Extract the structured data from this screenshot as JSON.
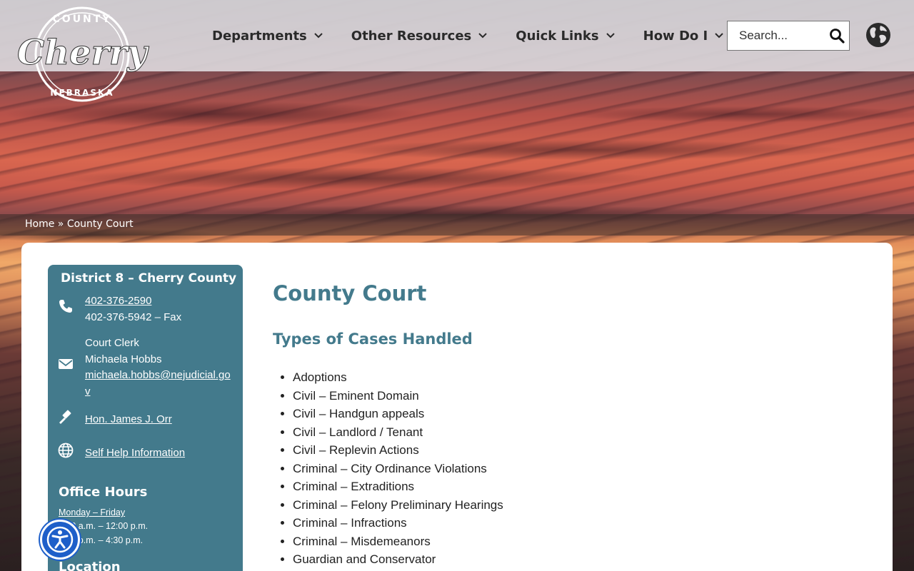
{
  "logo": {
    "top_text": "COUNTY",
    "script_text": "Cherry",
    "bottom_text": "NEBRASKA"
  },
  "nav": {
    "items": [
      {
        "label": "Departments"
      },
      {
        "label": "Other Resources"
      },
      {
        "label": "Quick Links"
      },
      {
        "label": "How Do I"
      }
    ]
  },
  "search": {
    "placeholder": "Search..."
  },
  "breadcrumb": {
    "home": "Home",
    "separator": " » ",
    "current": "County Court"
  },
  "sidebar": {
    "title": "District 8 – Cherry County",
    "phone": "402-376-2590",
    "fax": "402-376-5942 – Fax",
    "clerk_role": "Court Clerk",
    "clerk_name": "Michaela Hobbs",
    "clerk_email": "michaela.hobbs@nejudicial.gov",
    "judge": "Hon. James J. Orr",
    "self_help": "Self Help Information",
    "office_hours_title": "Office Hours",
    "office_days": "Monday – Friday",
    "hours_1": "8:00 a.m. – 12:00 p.m.",
    "hours_2": "1:00 p.m. – 4:30 p.m.",
    "location_title": "Location"
  },
  "main": {
    "title": "County Court",
    "section_title": "Types of Cases Handled",
    "cases": [
      "Adoptions",
      "Civil – Eminent Domain",
      "Civil – Handgun appeals",
      "Civil – Landlord / Tenant",
      "Civil – Replevin Actions",
      "Criminal – City Ordinance Violations",
      "Criminal – Extraditions",
      "Criminal – Felony Preliminary Hearings",
      "Criminal – Infractions",
      "Criminal – Misdemeanors",
      "Guardian and Conservator"
    ]
  },
  "colors": {
    "accent": "#437a8c",
    "header_bg": "#e1dee1",
    "a11y_blue": "#1e5fc9"
  },
  "icons": {
    "search": "search-icon",
    "globe": "globe-icon",
    "phone": "phone-icon",
    "email": "envelope-icon",
    "judge": "gavel-icon",
    "self_help": "globe-icon",
    "accessibility": "accessibility-icon"
  }
}
